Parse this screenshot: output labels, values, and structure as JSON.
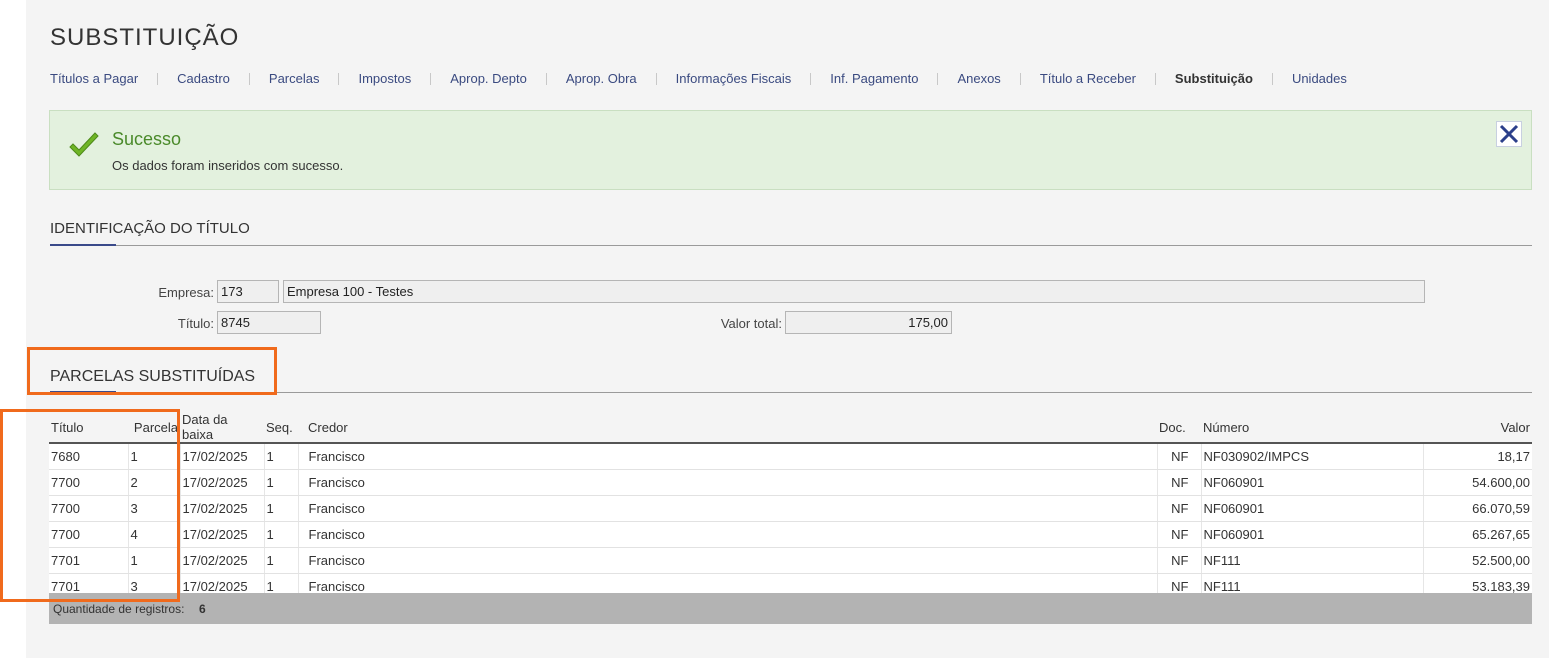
{
  "page": {
    "title": "SUBSTITUIÇÃO"
  },
  "tabs": [
    {
      "label": "Títulos a Pagar"
    },
    {
      "label": "Cadastro"
    },
    {
      "label": "Parcelas"
    },
    {
      "label": "Impostos"
    },
    {
      "label": "Aprop. Depto"
    },
    {
      "label": "Aprop. Obra"
    },
    {
      "label": "Informações Fiscais"
    },
    {
      "label": "Inf. Pagamento"
    },
    {
      "label": "Anexos"
    },
    {
      "label": "Título a Receber"
    },
    {
      "label": "Substituição",
      "active": true
    },
    {
      "label": "Unidades"
    }
  ],
  "alert": {
    "title": "Sucesso",
    "message": "Os dados foram inseridos com sucesso.",
    "color": "#4a8a2a"
  },
  "identificacao": {
    "title": "IDENTIFICAÇÃO DO TÍTULO",
    "empresa_label": "Empresa:",
    "empresa_code": "173",
    "empresa_name": "Empresa 100 - Testes",
    "titulo_label": "Título:",
    "titulo_value": "8745",
    "valor_label": "Valor total:",
    "valor_value": "175,00"
  },
  "parcelas": {
    "title": "PARCELAS SUBSTITUÍDAS",
    "columns": {
      "titulo": "Título",
      "parcela": "Parcela",
      "data": "Data da baixa",
      "seq": "Seq.",
      "credor": "Credor",
      "doc": "Doc.",
      "numero": "Número",
      "valor": "Valor"
    },
    "rows": [
      {
        "titulo": "7680",
        "parcela": "1",
        "data": "17/02/2025",
        "seq": "1",
        "credor": "Francisco",
        "doc": "NF",
        "numero": "NF030902/IMPCS",
        "valor": "18,17"
      },
      {
        "titulo": "7700",
        "parcela": "2",
        "data": "17/02/2025",
        "seq": "1",
        "credor": "Francisco",
        "doc": "NF",
        "numero": "NF060901",
        "valor": "54.600,00"
      },
      {
        "titulo": "7700",
        "parcela": "3",
        "data": "17/02/2025",
        "seq": "1",
        "credor": "Francisco",
        "doc": "NF",
        "numero": "NF060901",
        "valor": "66.070,59"
      },
      {
        "titulo": "7700",
        "parcela": "4",
        "data": "17/02/2025",
        "seq": "1",
        "credor": "Francisco",
        "doc": "NF",
        "numero": "NF060901",
        "valor": "65.267,65"
      },
      {
        "titulo": "7701",
        "parcela": "1",
        "data": "17/02/2025",
        "seq": "1",
        "credor": "Francisco",
        "doc": "NF",
        "numero": "NF111",
        "valor": "52.500,00"
      },
      {
        "titulo": "7701",
        "parcela": "3",
        "data": "17/02/2025",
        "seq": "1",
        "credor": "Francisco",
        "doc": "NF",
        "numero": "NF111",
        "valor": "53.183,39"
      }
    ],
    "footer_label": "Quantidade de registros:",
    "footer_count": "6"
  },
  "annotations": {
    "highlight_color": "#f06a1c"
  },
  "icons": {
    "success": "check-icon",
    "close": "close-icon"
  }
}
